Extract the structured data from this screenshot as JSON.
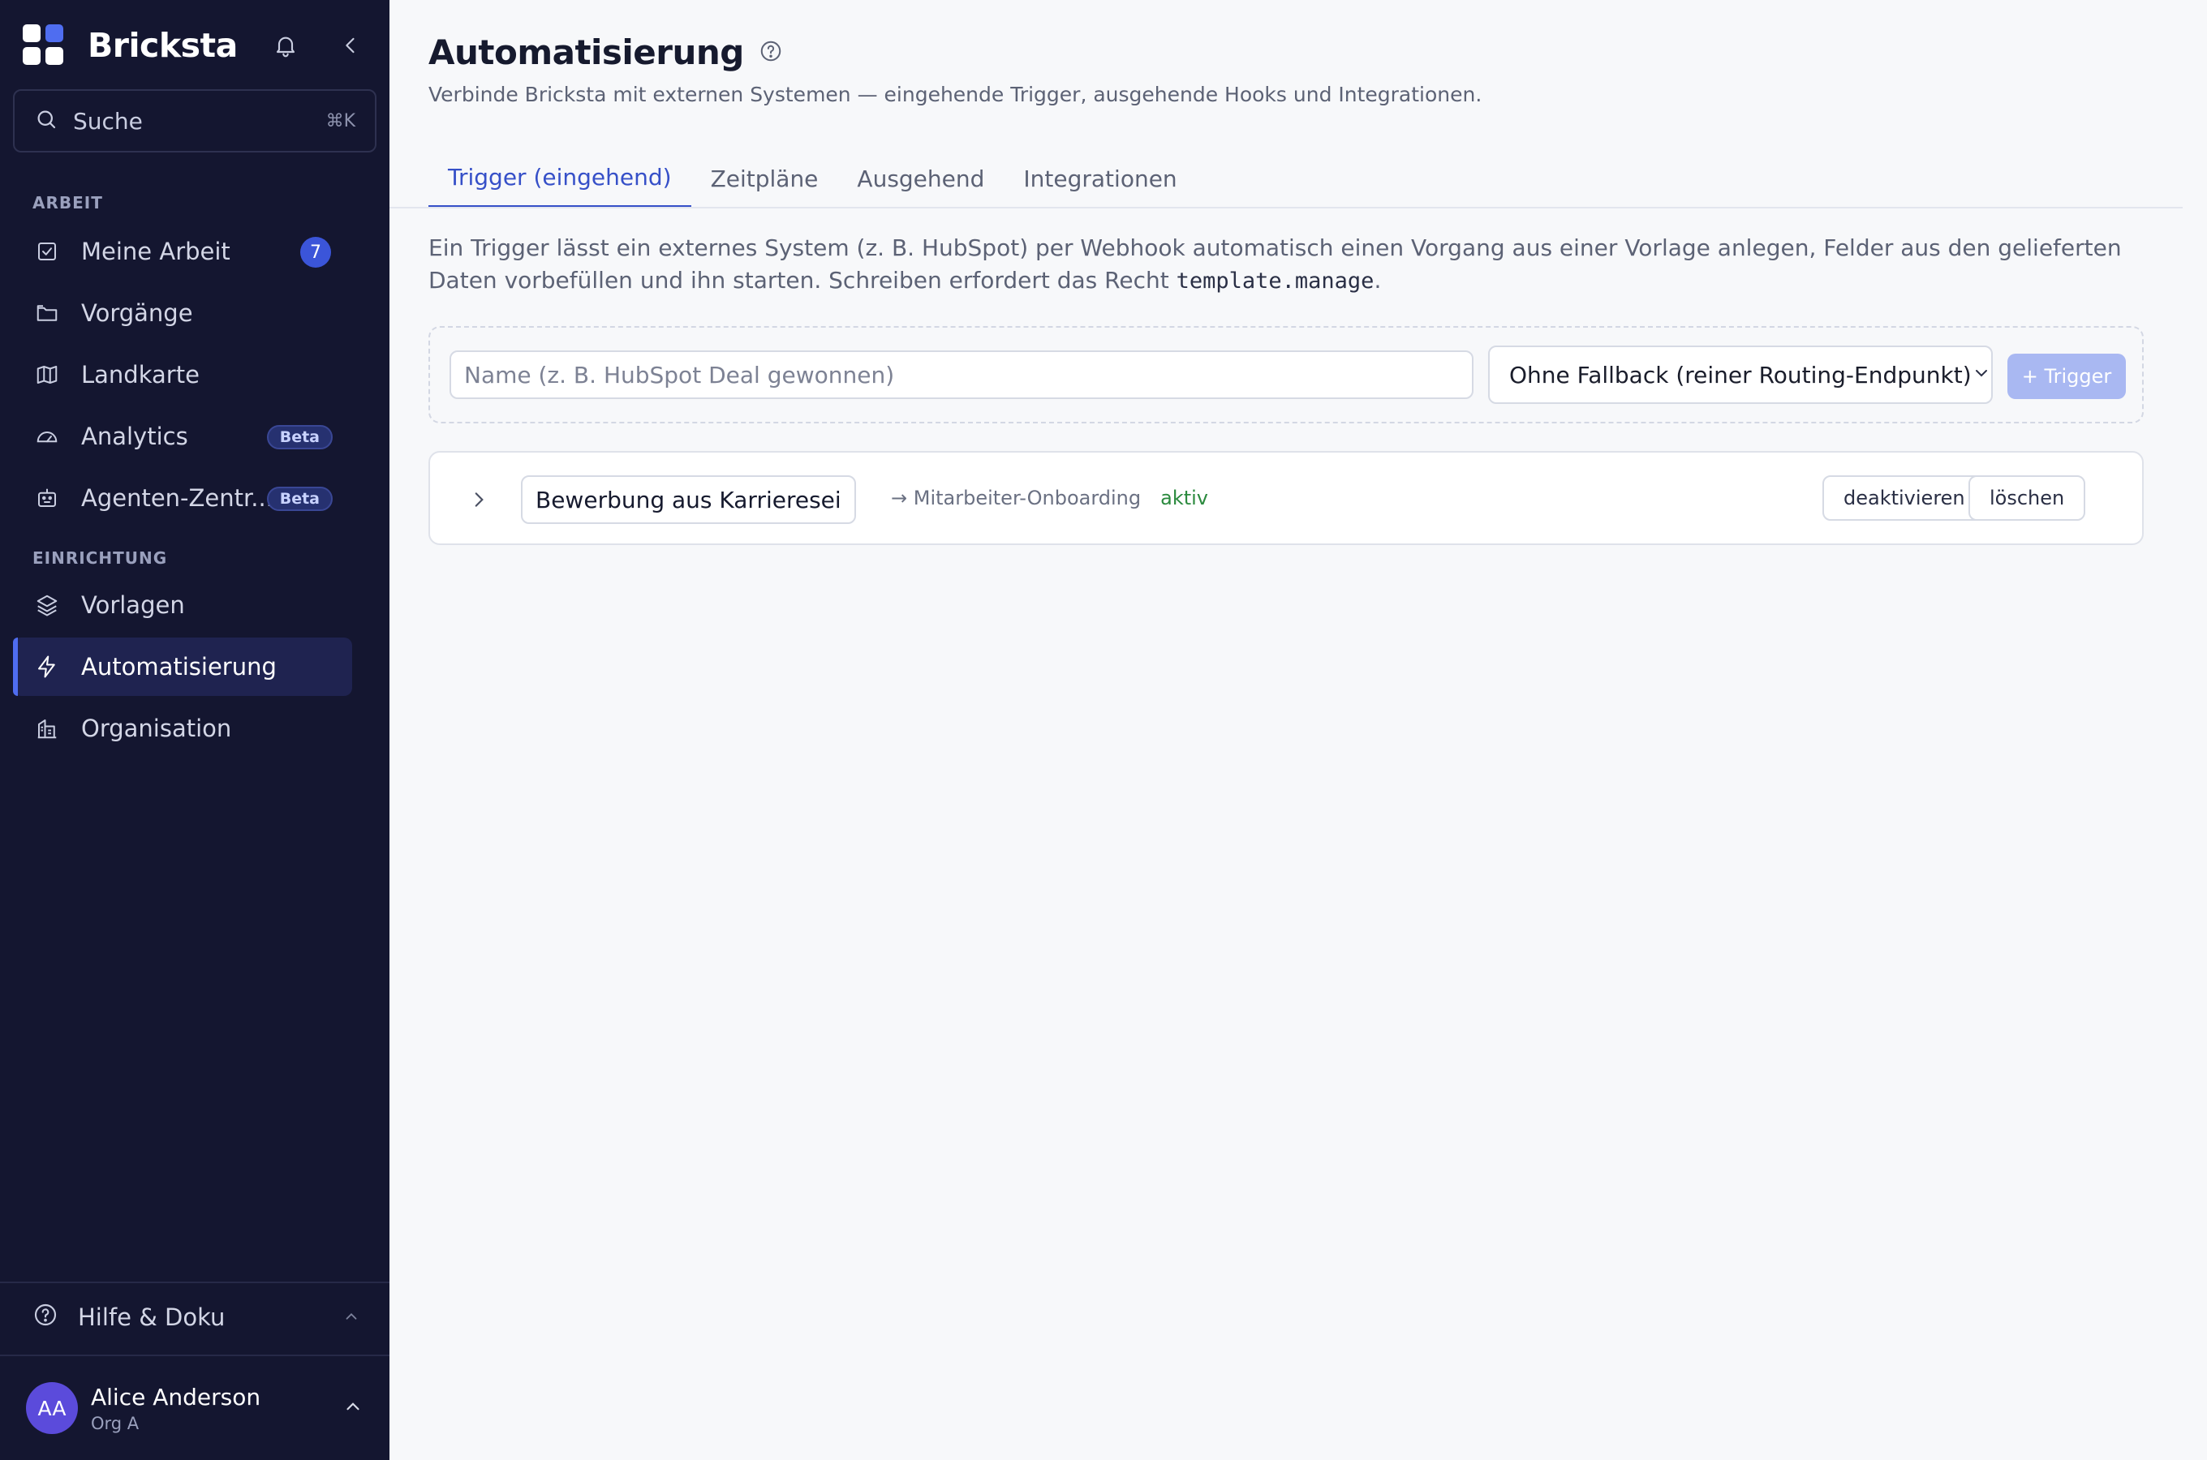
{
  "brand": {
    "name": "Bricksta"
  },
  "sidebar": {
    "search": {
      "label": "Suche",
      "shortcut": "⌘K"
    },
    "sections": {
      "work": "ARBEIT",
      "setup": "EINRICHTUNG"
    },
    "items": [
      {
        "label": "Meine Arbeit",
        "icon": "checkbox-icon",
        "badge": "7"
      },
      {
        "label": "Vorgänge",
        "icon": "folder-icon"
      },
      {
        "label": "Landkarte",
        "icon": "map-icon"
      },
      {
        "label": "Analytics",
        "icon": "gauge-icon",
        "badge": "Beta"
      },
      {
        "label": "Agenten-Zentr...",
        "icon": "robot-icon",
        "badge": "Beta"
      },
      {
        "label": "Vorlagen",
        "icon": "layers-icon"
      },
      {
        "label": "Automatisierung",
        "icon": "lightning-icon",
        "active": true
      },
      {
        "label": "Organisation",
        "icon": "building-icon"
      }
    ],
    "help": {
      "label": "Hilfe & Doku"
    },
    "user": {
      "initials": "AA",
      "name": "Alice Anderson",
      "org": "Org A"
    }
  },
  "page": {
    "title": "Automatisierung",
    "subtitle": "Verbinde Bricksta mit externen Systemen — eingehende Trigger, ausgehende Hooks und Integrationen.",
    "tabs": [
      {
        "label": "Trigger (eingehend)",
        "active": true
      },
      {
        "label": "Zeitpläne"
      },
      {
        "label": "Ausgehend"
      },
      {
        "label": "Integrationen"
      }
    ],
    "description_before": "Ein Trigger lässt ein externes System (z. B. HubSpot) per Webhook automatisch einen Vorgang aus einer Vorlage anlegen, Felder aus den gelieferten Daten vorbefüllen und ihn starten. Schreiben erfordert das Recht ",
    "description_code": "template.manage",
    "description_after": "."
  },
  "create_form": {
    "name_placeholder": "Name (z. B. HubSpot Deal gewonnen)",
    "name_value": "",
    "fallback_selected": "Ohne Fallback (reiner Routing-Endpunkt)",
    "add_label": "+ Trigger"
  },
  "triggers": [
    {
      "name": "Bewerbung aus Karrieresei",
      "target": "→ Mitarbeiter-Onboarding",
      "status": "aktiv",
      "deactivate_label": "deaktivieren",
      "delete_label": "löschen"
    }
  ],
  "colors": {
    "sidebar_bg": "#141630",
    "accent": "#3650c8",
    "status_active": "#2b8a3e",
    "button_disabled": "#a9b8f2"
  }
}
